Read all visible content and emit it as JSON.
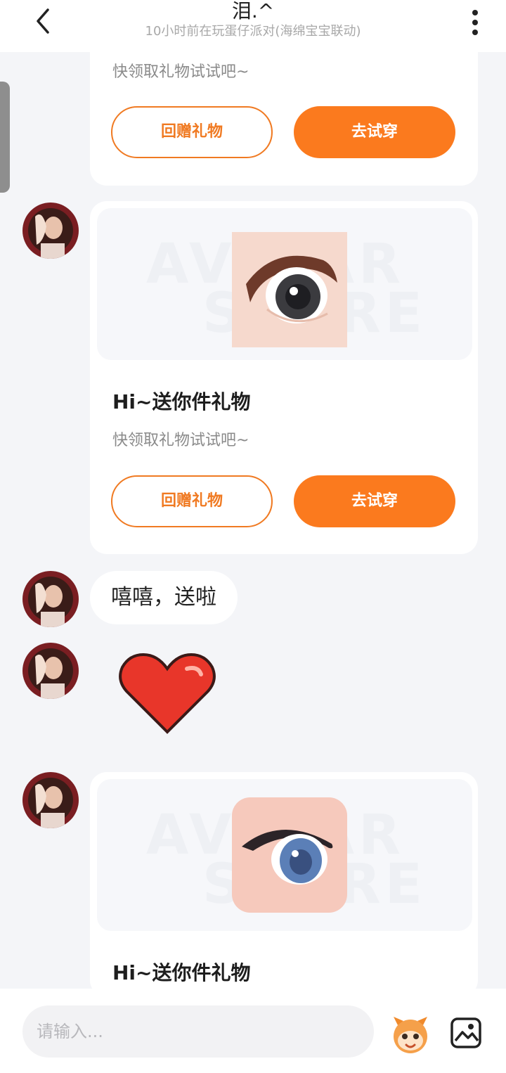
{
  "header": {
    "title": "泪.^",
    "subtitle": "10小时前在玩蛋仔派对(海绵宝宝联动)"
  },
  "messages": {
    "card0": {
      "desc": "快领取礼物试试吧~",
      "return_label": "回赠礼物",
      "try_label": "去试穿"
    },
    "card1": {
      "watermark1": "AVATAR",
      "watermark2": "STORE",
      "title": "Hi~送你件礼物",
      "desc": "快领取礼物试试吧~",
      "return_label": "回赠礼物",
      "try_label": "去试穿"
    },
    "text_bubble": "嘻嘻，送啦",
    "card2": {
      "watermark1": "AVATAR",
      "watermark2": "STORE",
      "title": "Hi~送你件礼物"
    }
  },
  "input": {
    "placeholder": "请输入..."
  },
  "icons": {
    "back": "chevron-left-icon",
    "more": "more-vertical-icon",
    "sticker": "mascot-icon",
    "image": "image-icon"
  },
  "colors": {
    "accent": "#fb7a1e",
    "background": "#f4f5f8"
  }
}
